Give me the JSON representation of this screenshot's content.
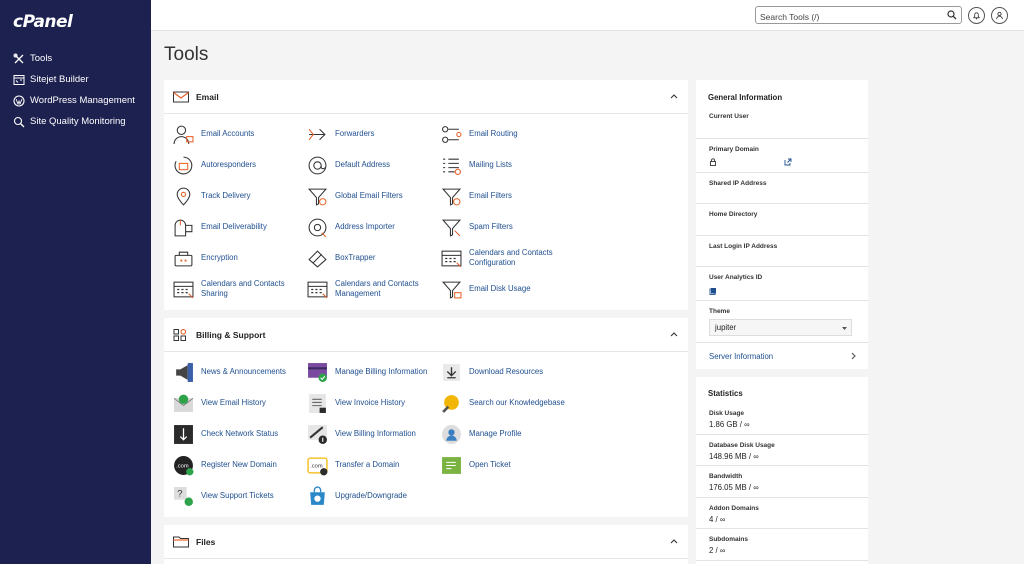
{
  "app": {
    "logo": "cPanel",
    "page_title": "Tools"
  },
  "nav": [
    {
      "label": "Tools",
      "icon": "tools-icon"
    },
    {
      "label": "Sitejet Builder",
      "icon": "sitejet-icon"
    },
    {
      "label": "WordPress Management",
      "icon": "wordpress-icon"
    },
    {
      "label": "Site Quality Monitoring",
      "icon": "site-quality-icon"
    }
  ],
  "search": {
    "placeholder": "Search Tools (/)"
  },
  "panels": {
    "email": {
      "title": "Email",
      "items": [
        "Email Accounts",
        "Forwarders",
        "Email Routing",
        "Autoresponders",
        "Default Address",
        "Mailing Lists",
        "Track Delivery",
        "Global Email Filters",
        "Email Filters",
        "Email Deliverability",
        "Address Importer",
        "Spam Filters",
        "Encryption",
        "BoxTrapper",
        "Calendars and Contacts Configuration",
        "Calendars and Contacts Sharing",
        "Calendars and Contacts Management",
        "Email Disk Usage"
      ]
    },
    "billing": {
      "title": "Billing & Support",
      "items": [
        "News & Announcements",
        "Manage Billing Information",
        "Download Resources",
        "View Email History",
        "View Invoice History",
        "Search our Knowledgebase",
        "Check Network Status",
        "View Billing Information",
        "Manage Profile",
        "Register New Domain",
        "Transfer a Domain",
        "Open Ticket",
        "View Support Tickets",
        "Upgrade/Downgrade"
      ]
    },
    "files": {
      "title": "Files"
    }
  },
  "general_info": {
    "title": "General Information",
    "current_user_label": "Current User",
    "primary_domain_label": "Primary Domain",
    "shared_ip_label": "Shared IP Address",
    "home_dir_label": "Home Directory",
    "last_login_label": "Last Login IP Address",
    "analytics_label": "User Analytics ID",
    "theme_label": "Theme",
    "theme_value": "jupiter",
    "server_info": "Server Information"
  },
  "statistics": {
    "title": "Statistics",
    "rows": [
      {
        "label": "Disk Usage",
        "value": "1.86 GB / ∞"
      },
      {
        "label": "Database Disk Usage",
        "value": "148.96 MB / ∞"
      },
      {
        "label": "Bandwidth",
        "value": "176.05 MB / ∞"
      },
      {
        "label": "Addon Domains",
        "value": "4 / ∞"
      },
      {
        "label": "Subdomains",
        "value": "2 / ∞"
      }
    ]
  },
  "colors": {
    "sidebar": "#1d2150",
    "link": "#1f4f8f",
    "accent_orange": "#e8632b"
  }
}
